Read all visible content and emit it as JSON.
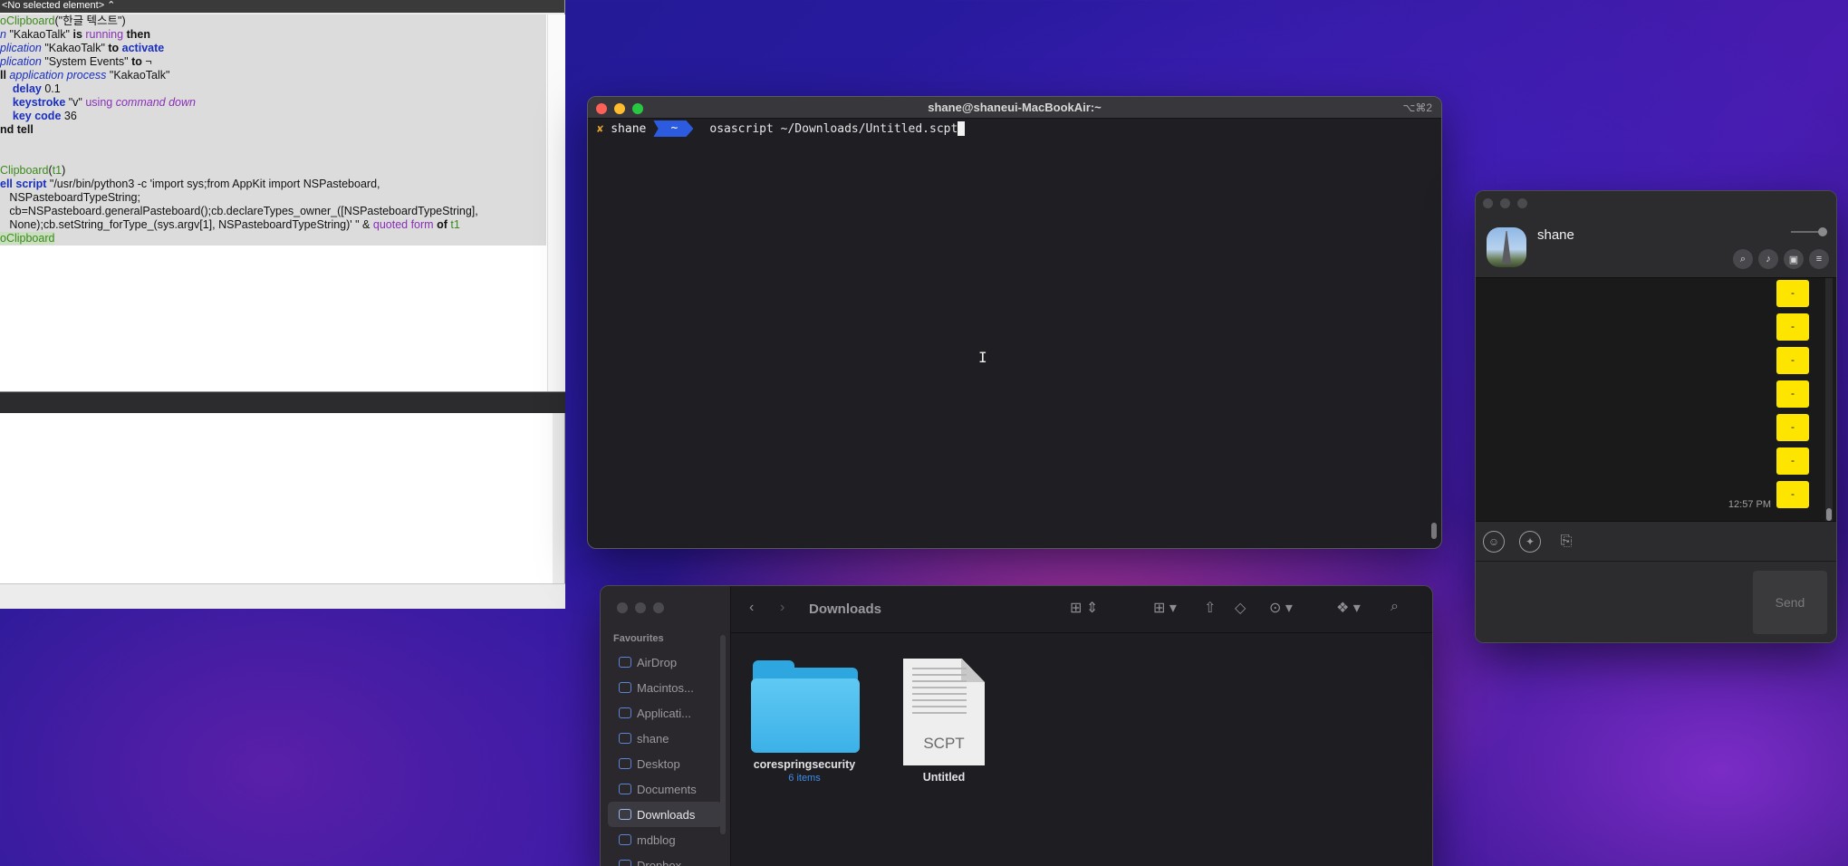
{
  "script_editor": {
    "top_bar_label": "<No selected element> ⌃",
    "code": [
      {
        "parts": [
          {
            "t": "oClipboard",
            "c": "vr"
          },
          {
            "t": "(\"한글 텍스트\")",
            "c": ""
          }
        ]
      },
      {
        "parts": [
          {
            "t": "n ",
            "c": "it"
          },
          {
            "t": "\"KakaoTalk\" ",
            "c": ""
          },
          {
            "t": "is ",
            "c": "kwb"
          },
          {
            "t": "running ",
            "c": "pu"
          },
          {
            "t": "then",
            "c": "kwb"
          }
        ]
      },
      {
        "parts": [
          {
            "t": "plication ",
            "c": "it"
          },
          {
            "t": "\"KakaoTalk\" ",
            "c": ""
          },
          {
            "t": "to ",
            "c": "kwb"
          },
          {
            "t": "activate",
            "c": "kw"
          }
        ]
      },
      {
        "parts": [
          {
            "t": "plication ",
            "c": "it"
          },
          {
            "t": "\"System Events\" ",
            "c": ""
          },
          {
            "t": "to ",
            "c": "kwb"
          },
          {
            "t": "¬",
            "c": ""
          }
        ]
      },
      {
        "parts": [
          {
            "t": "ll ",
            "c": "kwb"
          },
          {
            "t": "application process ",
            "c": "it"
          },
          {
            "t": "\"KakaoTalk\"",
            "c": ""
          }
        ]
      },
      {
        "parts": [
          {
            "t": "    delay ",
            "c": "kw"
          },
          {
            "t": "0.1",
            "c": ""
          }
        ]
      },
      {
        "parts": [
          {
            "t": "    keystroke ",
            "c": "kw"
          },
          {
            "t": "\"v\" ",
            "c": ""
          },
          {
            "t": "using ",
            "c": "pu"
          },
          {
            "t": "command down",
            "c": "pi"
          }
        ]
      },
      {
        "parts": [
          {
            "t": "    key code ",
            "c": "kw"
          },
          {
            "t": "36",
            "c": ""
          }
        ]
      },
      {
        "parts": [
          {
            "t": "nd tell",
            "c": "kwb"
          }
        ]
      },
      {
        "parts": []
      },
      {
        "parts": []
      },
      {
        "parts": [
          {
            "t": "Clipboard",
            "c": "vr"
          },
          {
            "t": "(",
            "c": ""
          },
          {
            "t": "t1",
            "c": "vr"
          },
          {
            "t": ")",
            "c": ""
          }
        ]
      },
      {
        "parts": [
          {
            "t": "ell script ",
            "c": "kw"
          },
          {
            "t": "\"/usr/bin/python3 -c 'import sys;from AppKit import NSPasteboard,",
            "c": ""
          }
        ]
      },
      {
        "parts": [
          {
            "t": "   NSPasteboardTypeString;",
            "c": ""
          }
        ]
      },
      {
        "parts": [
          {
            "t": "   cb=NSPasteboard.generalPasteboard();cb.declareTypes_owner_([NSPasteboardTypeString],",
            "c": ""
          }
        ]
      },
      {
        "parts": [
          {
            "t": "   None);cb.setString_forType_(sys.argv[1], NSPasteboardTypeString)' \" & ",
            "c": ""
          },
          {
            "t": "quoted form ",
            "c": "pu"
          },
          {
            "t": "of ",
            "c": "kwb"
          },
          {
            "t": "t1",
            "c": "vr"
          }
        ]
      },
      {
        "parts": [
          {
            "t": "oClipboard",
            "c": "vr sel"
          }
        ]
      }
    ]
  },
  "terminal": {
    "title": "shane@shaneui-MacBookAir:~",
    "shortcut": "⌥⌘2",
    "prompt_mark": "✘",
    "prompt_user": "shane",
    "prompt_dir": "~",
    "command": "osascript ~/Downloads/Untitled.scpt"
  },
  "finder": {
    "title": "Downloads",
    "section_title": "Favourites",
    "sidebar_items": [
      {
        "label": "AirDrop",
        "active": false
      },
      {
        "label": "Macintos...",
        "active": false
      },
      {
        "label": "Applicati...",
        "active": false
      },
      {
        "label": "shane",
        "active": false
      },
      {
        "label": "Desktop",
        "active": false
      },
      {
        "label": "Documents",
        "active": false
      },
      {
        "label": "Downloads",
        "active": true
      },
      {
        "label": "mdblog",
        "active": false
      },
      {
        "label": "Dropbox",
        "active": false
      }
    ],
    "files": [
      {
        "name": "corespringsecurity",
        "sub": "6 items",
        "kind": "folder"
      },
      {
        "name": "Untitled",
        "sub": "",
        "kind": "scpt",
        "ext": "SCPT"
      }
    ]
  },
  "kakao": {
    "chat_name": "shane",
    "messages": [
      "-",
      "-",
      "-",
      "-",
      "-",
      "-",
      "-"
    ],
    "last_time": "12:57 PM",
    "send_label": "Send"
  }
}
